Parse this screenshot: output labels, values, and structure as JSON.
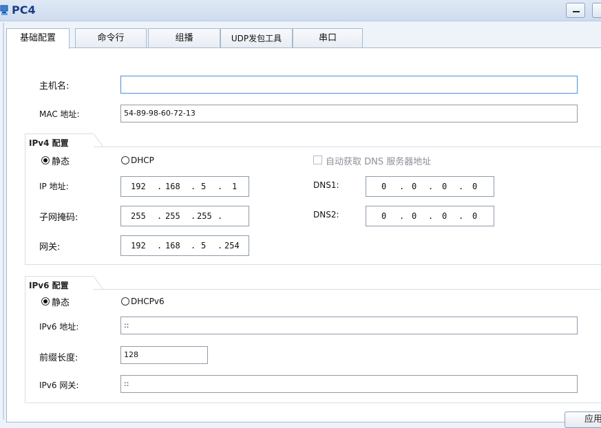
{
  "window": {
    "title": "PC4",
    "icon": "pc-icon"
  },
  "tabs": [
    "基础配置",
    "命令行",
    "组播",
    "UDP发包工具",
    "串口"
  ],
  "basic": {
    "hostname_label": "主机名:",
    "hostname_value": "",
    "mac_label": "MAC 地址:",
    "mac_value": "54-89-98-60-72-13"
  },
  "ipv4": {
    "section_title": "IPv4 配置",
    "static_label": "静态",
    "dhcp_label": "DHCP",
    "auto_dns_label": "自动获取 DNS 服务器地址",
    "ip_label": "IP 地址:",
    "ip_octets": [
      "192",
      "168",
      "5",
      "1"
    ],
    "mask_label": "子网掩码:",
    "mask_octets": [
      "255",
      "255",
      "255",
      ""
    ],
    "gateway_label": "网关:",
    "gateway_octets": [
      "192",
      "168",
      "5",
      "254"
    ],
    "dns1_label": "DNS1:",
    "dns1_octets": [
      "0",
      "0",
      "0",
      "0"
    ],
    "dns2_label": "DNS2:",
    "dns2_octets": [
      "0",
      "0",
      "0",
      "0"
    ],
    "static_selected": true,
    "auto_dns_checked": false
  },
  "ipv6": {
    "section_title": "IPv6 配置",
    "static_label": "静态",
    "dhcp_label": "DHCPv6",
    "addr_label": "IPv6 地址:",
    "addr_value": "::",
    "prefix_label": "前缀长度:",
    "prefix_value": "128",
    "gateway_label": "IPv6 网关:",
    "gateway_value": "::",
    "static_selected": true
  },
  "apply_label": "应用"
}
